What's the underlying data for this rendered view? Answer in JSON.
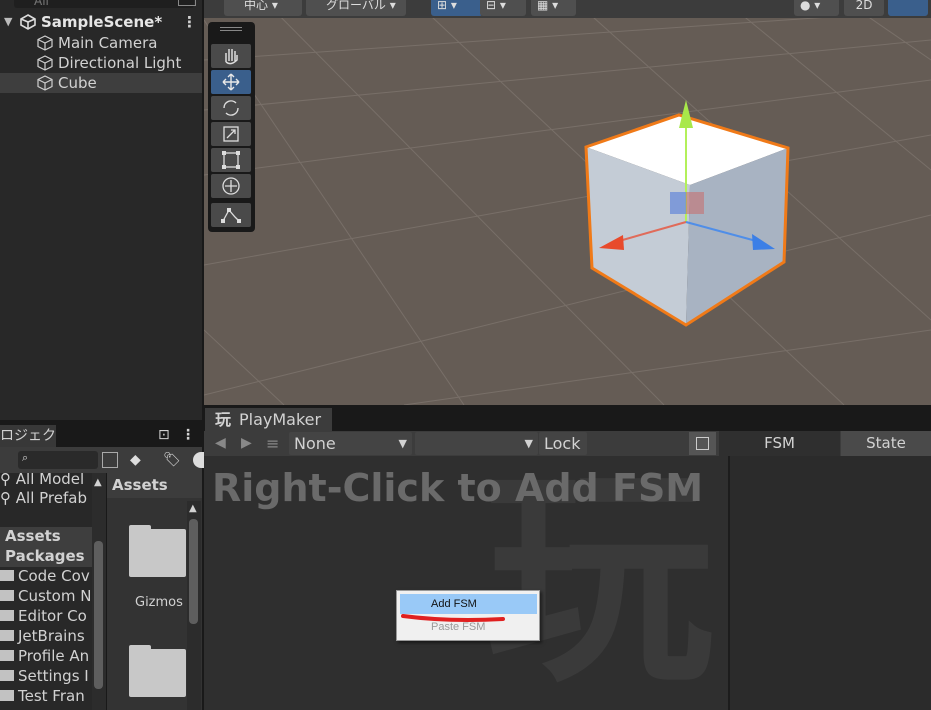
{
  "hierarchy": {
    "search_placeholder": "All",
    "scene_name": "SampleScene*",
    "items": [
      {
        "label": "Main Camera"
      },
      {
        "label": "Directional Light"
      },
      {
        "label": "Cube"
      }
    ]
  },
  "scene_toolbar": {
    "pivot_label": "中心",
    "space_label": "グローバル",
    "mode_2d": "2D"
  },
  "project": {
    "tab_label": "ロジェクト",
    "favorites": [
      "All Model",
      "All Prefab"
    ],
    "assets_header": "Assets",
    "tree": [
      {
        "label": "Assets",
        "bold": true
      },
      {
        "label": "Packages",
        "bold": true
      },
      {
        "label": "Code Cov"
      },
      {
        "label": "Custom N"
      },
      {
        "label": "Editor Co"
      },
      {
        "label": "JetBrains"
      },
      {
        "label": "Profile An"
      },
      {
        "label": "Settings I"
      },
      {
        "label": "Test Fran"
      }
    ],
    "folders": [
      {
        "label": "Gizmos"
      },
      {
        "label": ""
      }
    ]
  },
  "playmaker": {
    "tab_label": "PlayMaker",
    "gameobject_select": "None",
    "fsm_select": "",
    "lock_label": "Lock",
    "tab_fsm": "FSM",
    "tab_state": "State",
    "hint": "Right-Click to Add FSM",
    "watermark": "玩",
    "context_menu": {
      "add": "Add FSM",
      "paste": "Paste FSM"
    },
    "colors": {
      "menu_highlight": "#99c9f7",
      "annotation": "#e02020"
    }
  }
}
